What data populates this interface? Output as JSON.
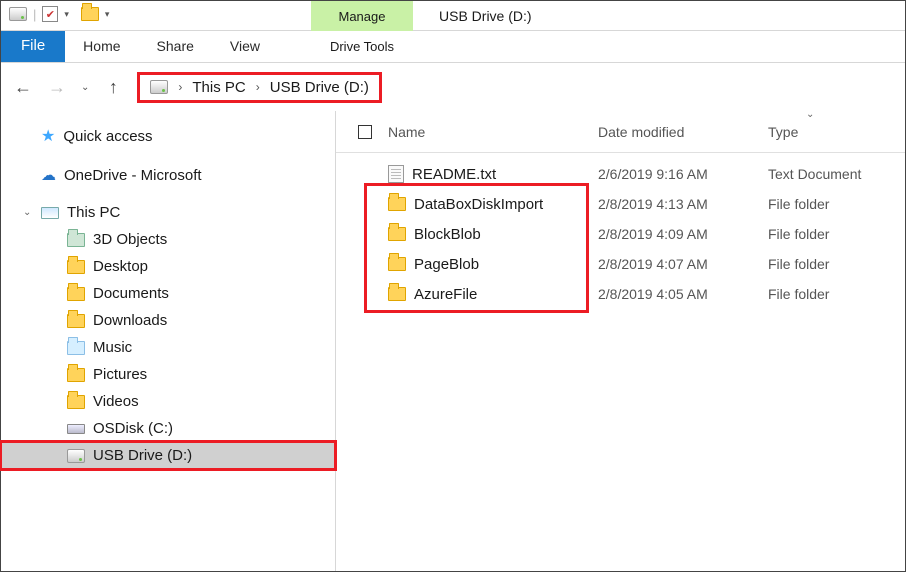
{
  "window": {
    "context_tab": "Manage",
    "title": "USB Drive (D:)"
  },
  "ribbon": {
    "file": "File",
    "tabs": [
      "Home",
      "Share",
      "View"
    ],
    "tool_tab": "Drive Tools"
  },
  "breadcrumb": {
    "segments": [
      "This PC",
      "USB Drive (D:)"
    ]
  },
  "nav_tree": {
    "quick_access": "Quick access",
    "onedrive": "OneDrive - Microsoft",
    "this_pc": "This PC",
    "children": [
      {
        "label": "3D Objects",
        "accent": "accent-3d"
      },
      {
        "label": "Desktop",
        "accent": ""
      },
      {
        "label": "Documents",
        "accent": ""
      },
      {
        "label": "Downloads",
        "accent": ""
      },
      {
        "label": "Music",
        "accent": "accent-music"
      },
      {
        "label": "Pictures",
        "accent": ""
      },
      {
        "label": "Videos",
        "accent": ""
      },
      {
        "label": "OSDisk (C:)",
        "icon": "disk"
      },
      {
        "label": "USB Drive (D:)",
        "icon": "drive",
        "selected": true
      }
    ]
  },
  "columns": {
    "name": "Name",
    "date": "Date modified",
    "type": "Type"
  },
  "files": [
    {
      "icon": "file",
      "name": "README.txt",
      "date": "2/6/2019 9:16 AM",
      "type": "Text Document"
    },
    {
      "icon": "folder",
      "name": "DataBoxDiskImport",
      "date": "2/8/2019 4:13 AM",
      "type": "File folder"
    },
    {
      "icon": "folder",
      "name": "BlockBlob",
      "date": "2/8/2019 4:09 AM",
      "type": "File folder"
    },
    {
      "icon": "folder",
      "name": "PageBlob",
      "date": "2/8/2019 4:07 AM",
      "type": "File folder"
    },
    {
      "icon": "folder",
      "name": "AzureFile",
      "date": "2/8/2019 4:05 AM",
      "type": "File folder"
    }
  ]
}
